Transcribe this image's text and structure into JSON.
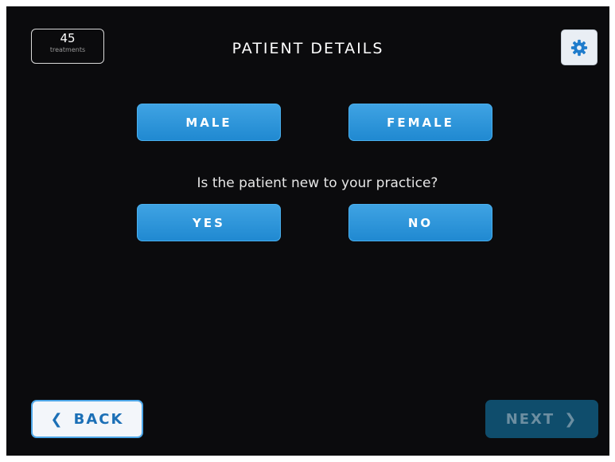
{
  "header": {
    "title": "PATIENT DETAILS",
    "counter": {
      "value": "45",
      "label": "treatments"
    },
    "settings_icon": "gear-icon"
  },
  "gender": {
    "male_label": "MALE",
    "female_label": "FEMALE"
  },
  "new_patient": {
    "question": "Is the patient new to your practice?",
    "yes_label": "YES",
    "no_label": "NO"
  },
  "footer": {
    "back_label": "BACK",
    "back_icon": "chevron-left-icon",
    "next_label": "NEXT",
    "next_icon": "chevron-right-icon"
  },
  "colors": {
    "background": "#0b0b0d",
    "button_blue": "#2b95db",
    "next_disabled": "#0f4d6c",
    "back_text": "#1b6fb6"
  }
}
